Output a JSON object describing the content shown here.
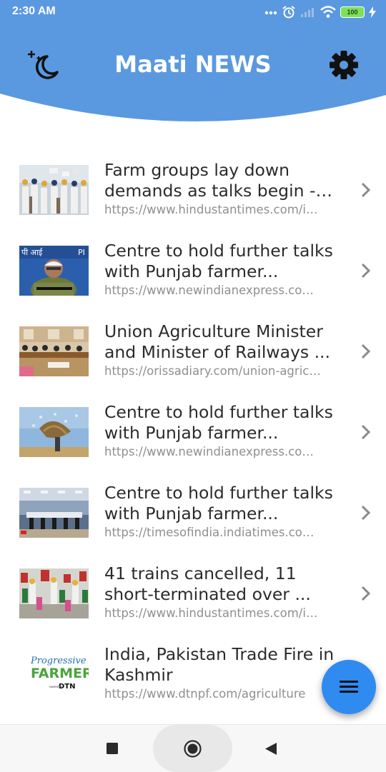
{
  "status_bar": {
    "time": "2:30 AM",
    "battery": "100",
    "icons": [
      "dots-icon",
      "alarm-icon",
      "signal-icon",
      "wifi-icon",
      "battery-icon",
      "charging-icon"
    ]
  },
  "header": {
    "title": "Maati NEWS",
    "background_color": "#5a99df",
    "left_icon": "night-mode-icon",
    "right_icon": "gear-icon"
  },
  "news": [
    {
      "title": "Farm groups lay down demands as talks begin - ...",
      "url": "https://www.hindustantimes.com/india-news/farm-groups"
    },
    {
      "title": "Centre to hold further talks with Punjab farmer...",
      "url": "https://www.newindianexpress.com/nation"
    },
    {
      "title": "Union Agriculture Minister and Minister of Railways ...",
      "url": "https://orissadiary.com/union-agriculture"
    },
    {
      "title": "Centre to hold further talks with Punjab farmer...",
      "url": "https://www.newindianexpress.com/nation"
    },
    {
      "title": "Centre to hold further talks with Punjab farmer...",
      "url": "https://timesofindia.indiatimes.com/india"
    },
    {
      "title": "41 trains cancelled, 11 short-terminated over ...",
      "url": "https://www.hindustantimes.com/india-news"
    },
    {
      "title": "India, Pakistan Trade Fire in Kashmir",
      "url": "https://www.dtnpf.com/agriculture",
      "logo": {
        "line1": "Progressive",
        "line2": "FARMER",
        "line3": "DTN"
      }
    }
  ],
  "fab": {
    "icon": "menu-icon",
    "color": "#2f8bf0"
  },
  "nav": {
    "icons": [
      "recents-square-icon",
      "home-circle-icon",
      "back-triangle-icon"
    ]
  }
}
